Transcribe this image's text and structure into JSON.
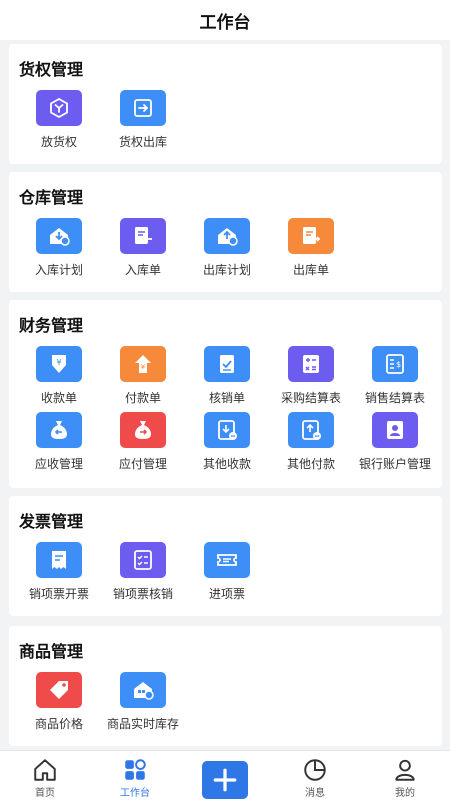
{
  "header": {
    "title": "工作台"
  },
  "sections": [
    {
      "title": "货权管理",
      "items": [
        {
          "label": "放货权",
          "icon": "release-rights-icon",
          "color": "#6c5cf0"
        },
        {
          "label": "货权出库",
          "icon": "rights-outbound-icon",
          "color": "#3e8ef7"
        }
      ]
    },
    {
      "title": "仓库管理",
      "items": [
        {
          "label": "入库计划",
          "icon": "inbound-plan-icon",
          "color": "#3e8ef7"
        },
        {
          "label": "入库单",
          "icon": "inbound-order-icon",
          "color": "#6c5cf0"
        },
        {
          "label": "出库计划",
          "icon": "outbound-plan-icon",
          "color": "#3e8ef7"
        },
        {
          "label": "出库单",
          "icon": "outbound-order-icon",
          "color": "#f7893b"
        }
      ]
    },
    {
      "title": "财务管理",
      "items": [
        {
          "label": "收款单",
          "icon": "receipt-icon",
          "color": "#3e8ef7"
        },
        {
          "label": "付款单",
          "icon": "payment-icon",
          "color": "#f7893b"
        },
        {
          "label": "核销单",
          "icon": "write-off-icon",
          "color": "#3e8ef7"
        },
        {
          "label": "采购结算表",
          "icon": "calculator-icon",
          "color": "#6c5cf0"
        },
        {
          "label": "销售结算表",
          "icon": "sales-statement-icon",
          "color": "#3e8ef7"
        },
        {
          "label": "应收管理",
          "icon": "receivable-icon",
          "color": "#3e8ef7"
        },
        {
          "label": "应付管理",
          "icon": "payable-icon",
          "color": "#f04b4b"
        },
        {
          "label": "其他收款",
          "icon": "other-receipt-icon",
          "color": "#3e8ef7"
        },
        {
          "label": "其他付款",
          "icon": "other-payment-icon",
          "color": "#3e8ef7"
        },
        {
          "label": "银行账户管理",
          "icon": "bank-account-icon",
          "color": "#6c5cf0"
        }
      ]
    },
    {
      "title": "发票管理",
      "items": [
        {
          "label": "销项票开票",
          "icon": "invoice-issue-icon",
          "color": "#3e8ef7"
        },
        {
          "label": "销项票核销",
          "icon": "invoice-checklist-icon",
          "color": "#6c5cf0"
        },
        {
          "label": "进项票",
          "icon": "ticket-icon",
          "color": "#3e8ef7"
        }
      ]
    },
    {
      "title": "商品管理",
      "items": [
        {
          "label": "商品价格",
          "icon": "price-tag-icon",
          "color": "#f04b4b"
        },
        {
          "label": "商品实时库存",
          "icon": "realtime-stock-icon",
          "color": "#3e8ef7"
        }
      ]
    }
  ],
  "tabbar": {
    "items": [
      {
        "label": "首页",
        "icon": "home-icon"
      },
      {
        "label": "工作台",
        "icon": "workbench-icon",
        "active": true
      },
      {
        "label": "",
        "icon": "plus-icon"
      },
      {
        "label": "消息",
        "icon": "message-icon"
      },
      {
        "label": "我的",
        "icon": "profile-icon"
      }
    ]
  },
  "colors": {
    "accent": "#2f76e6",
    "page_background": "#f2f3f5"
  }
}
